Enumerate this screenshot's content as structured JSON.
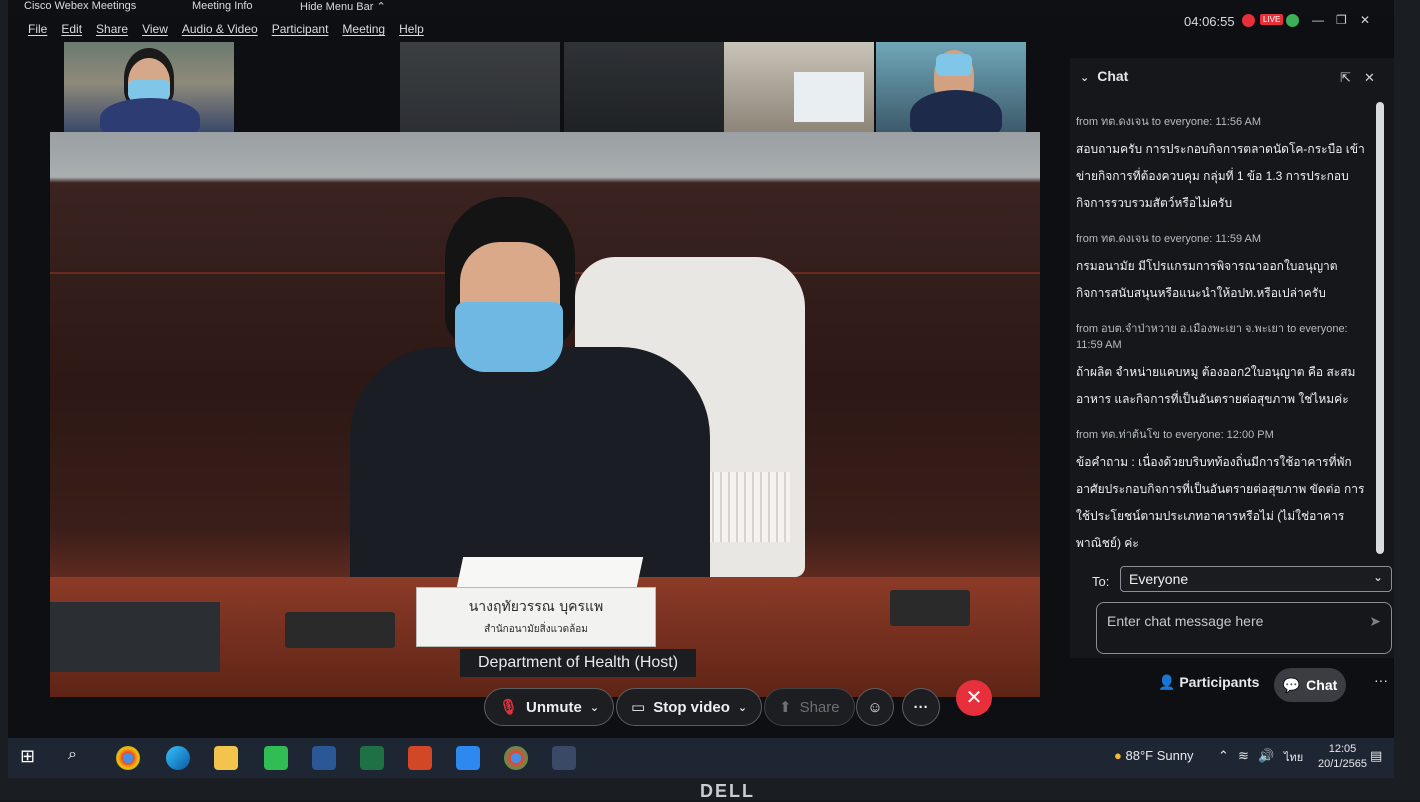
{
  "titlebar": {
    "app_name": "Cisco Webex Meetings",
    "meeting_info": "Meeting Info",
    "hide_menu_bar": "Hide Menu Bar",
    "clock": "04:06:55",
    "live_badge": "LIVE"
  },
  "menu": [
    "File",
    "Edit",
    "Share",
    "View",
    "Audio & Video",
    "Participant",
    "Meeting",
    "Help"
  ],
  "video": {
    "nameplate_line1": "นางฤทัยวรรณ บุครแพ",
    "nameplate_line2": "สำนักอนามัยสิ่งแวดล้อม",
    "host_label": "Department of Health (Host)"
  },
  "controls": {
    "unmute": "Unmute",
    "stop_video": "Stop video",
    "share": "Share",
    "participants": "Participants",
    "chat": "Chat",
    "more": "···"
  },
  "chat": {
    "title": "Chat",
    "messages": [
      {
        "meta": "from ทต.ดงเจน to everyone:   11:56 AM",
        "text": "สอบถามครับ การประกอบกิจการตลาดนัดโค-กระบือ เข้าข่ายกิจการที่ต้องควบคุม กลุ่มที่ 1 ข้อ 1.3 การประกอบกิจการรวบรวมสัตว์หรือไม่ครับ"
      },
      {
        "meta": "from ทต.ดงเจน to everyone:   11:59 AM",
        "text": "กรมอนามัย มีโปรแกรมการพิจารณาออกใบอนุญาตกิจการสนับสนุนหรือแนะนำให้อปท.หรือเปล่าครับ"
      },
      {
        "meta": "from อบต.จำป่าหวาย อ.เมืองพะเยา จ.พะเยา to everyone:   11:59 AM",
        "text": "ถ้าผลิต จำหน่ายแคบหมู ต้องออก2ใบอนุญาต คือ สะสมอาหาร และกิจการที่เป็นอันตรายต่อสุขภาพ ใช่ไหมค่ะ"
      },
      {
        "meta": "from ทต.ท่าต้นโข to everyone:   12:00 PM",
        "text": "ข้อคำถาม : เนื่องด้วยบริบทท้องถิ่นมีการใช้อาคารที่พักอาศัยประกอบกิจการที่เป็นอันตรายต่อสุขภาพ ขัดต่อ การใช้ประโยชน์ตามประเภทอาคารหรือไม่ (ไม่ใช่อาคารพาณิชย์) ค่ะ"
      }
    ],
    "to_label": "To:",
    "to_value": "Everyone",
    "input_placeholder": "Enter chat message here"
  },
  "taskbar": {
    "weather": "88°F Sunny",
    "lang": "ไทย",
    "time": "12:05",
    "date": "20/1/2565"
  },
  "monitor_brand": "DELL",
  "colors": {
    "end_call": "#e8303d",
    "chat_bg": "#15171a",
    "taskbar_bg": "#1f2633"
  }
}
